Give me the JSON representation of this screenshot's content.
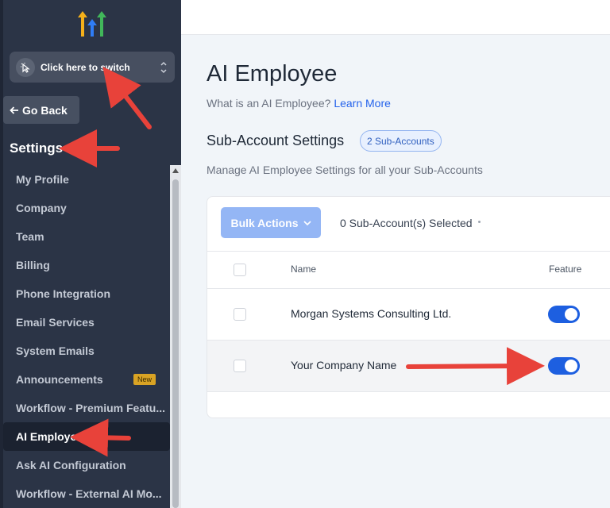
{
  "sidebar": {
    "switcher_label": "Click here to switch",
    "go_back_label": "Go Back",
    "section_title": "Settings",
    "items": [
      {
        "label": "My Profile"
      },
      {
        "label": "Company"
      },
      {
        "label": "Team"
      },
      {
        "label": "Billing"
      },
      {
        "label": "Phone Integration"
      },
      {
        "label": "Email Services"
      },
      {
        "label": "System Emails"
      },
      {
        "label": "Announcements",
        "badge": "New"
      },
      {
        "label": "Workflow - Premium Featu..."
      },
      {
        "label": "AI Employee",
        "active": true
      },
      {
        "label": "Ask AI Configuration"
      },
      {
        "label": "Workflow - External AI Mo..."
      }
    ]
  },
  "main": {
    "title": "AI Employee",
    "subtitle": "What is an AI Employee?",
    "learn_more": "Learn More",
    "section_title": "Sub-Account Settings",
    "section_badge": "2 Sub-Accounts",
    "section_desc": "Manage AI Employee Settings for all your Sub-Accounts",
    "bulk_actions": "Bulk Actions",
    "selected_text": "0 Sub-Account(s) Selected",
    "columns": {
      "name": "Name",
      "feature": "Feature"
    },
    "rows": [
      {
        "name": "Morgan Systems Consulting Ltd.",
        "enabled": true
      },
      {
        "name": "Your Company Name",
        "enabled": true
      }
    ]
  },
  "colors": {
    "sidebar_bg": "#2b3446",
    "accent": "#1d5fe0",
    "annotation_arrow": "#e8423a"
  }
}
